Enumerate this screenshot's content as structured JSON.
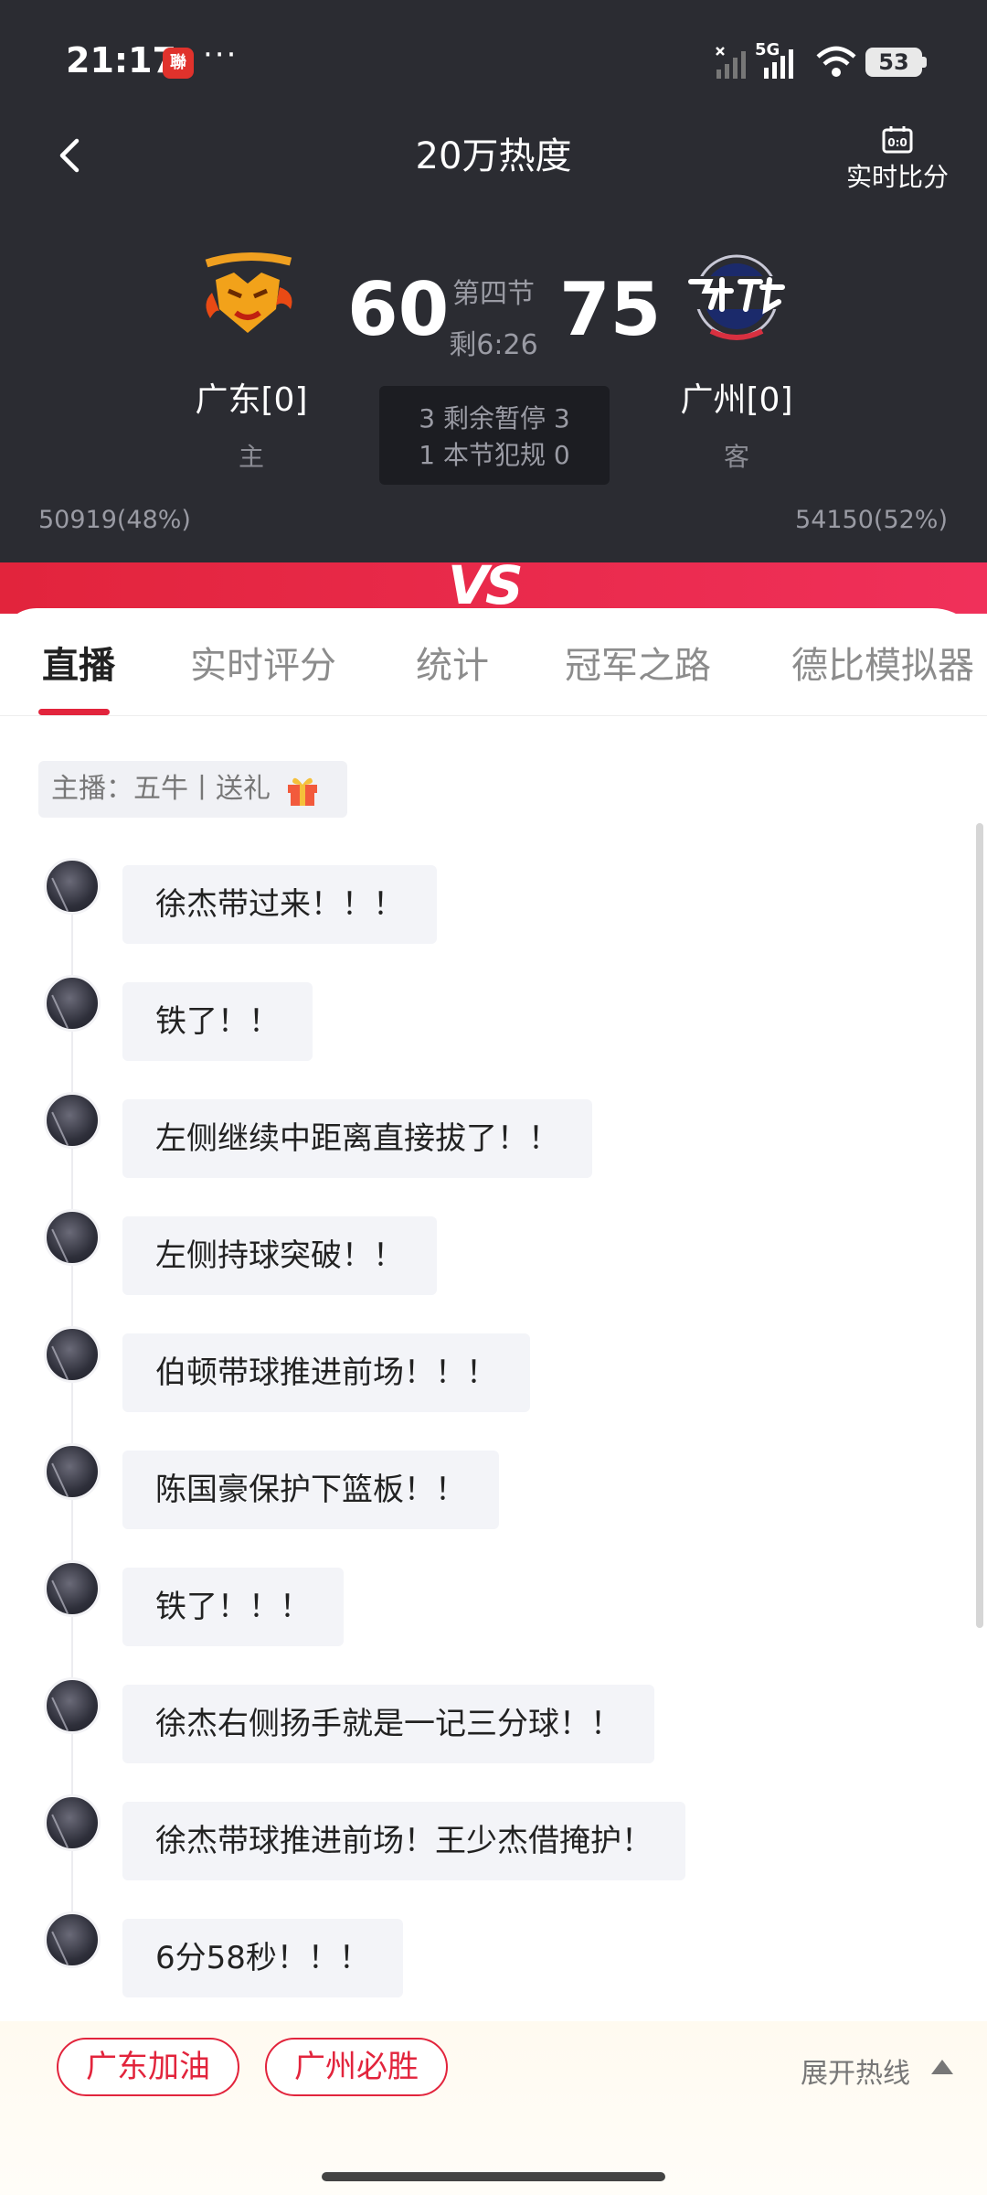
{
  "status_bar": {
    "time": "21:17",
    "app_badge": "聯",
    "more_dots": "···",
    "network": "5G",
    "battery": "53"
  },
  "nav": {
    "title": "20万热度",
    "live_score_label": "实时比分"
  },
  "game": {
    "home": {
      "name": "广东[0]",
      "side": "主",
      "score": "60",
      "support": "50919(48%)"
    },
    "away": {
      "name": "广州[0]",
      "side": "客",
      "score": "75",
      "support": "54150(52%)"
    },
    "period": "第四节",
    "clock": "剩6:26",
    "timeouts_row": "3 剩余暂停 3",
    "fouls_row": "1 本节犯规 0",
    "vs": "VS"
  },
  "tabs": [
    {
      "label": "直播",
      "active": true
    },
    {
      "label": "实时评分",
      "active": false
    },
    {
      "label": "统计",
      "active": false
    },
    {
      "label": "冠军之路",
      "active": false
    },
    {
      "label": "德比模拟器",
      "active": false
    }
  ],
  "anchor": {
    "text": "主播：五牛丨送礼"
  },
  "messages": [
    "徐杰带过来！！！",
    "铁了！！",
    "左侧继续中距离直接拔了！！",
    "左侧持球突破！！",
    "伯顿带球推进前场！！！",
    "陈国豪保护下篮板！！",
    "铁了！！！",
    "徐杰右侧扬手就是一记三分球！！",
    "徐杰带球推进前场！王少杰借掩护！",
    "6分58秒！！！"
  ],
  "bottom": {
    "cheer_home": "广东加油",
    "cheer_away": "广州必胜",
    "expand_label": "展开热线"
  },
  "colors": {
    "header_bg": "#2b2c32",
    "accent_red": "#e2243c",
    "bubble_bg": "#f3f4f8"
  }
}
